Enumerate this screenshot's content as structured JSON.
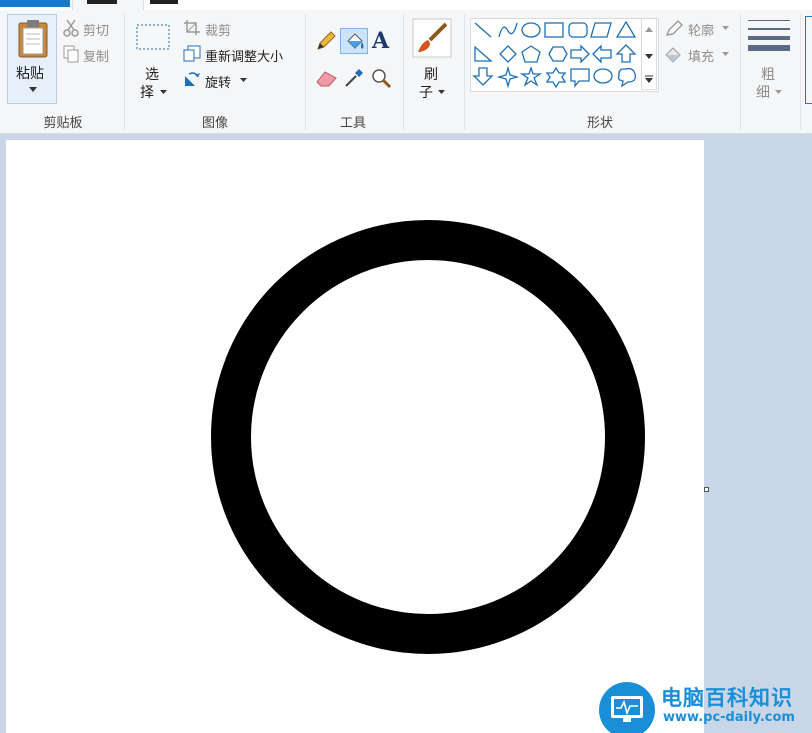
{
  "ribbon": {
    "clipboard": {
      "paste_label": "粘贴",
      "cut_label": "剪切",
      "copy_label": "复制",
      "group_label": "剪贴板"
    },
    "image": {
      "select_label_1": "选",
      "select_label_2": "择",
      "crop_label": "裁剪",
      "resize_label": "重新调整大小",
      "rotate_label": "旋转",
      "group_label": "图像"
    },
    "tools": {
      "group_label": "工具",
      "text_tool_glyph": "A"
    },
    "brushes": {
      "label_1": "刷",
      "label_2": "子"
    },
    "shapes": {
      "outline_label": "轮廓",
      "fill_label": "填充",
      "group_label": "形状"
    },
    "size": {
      "label_1": "粗",
      "label_2": "细"
    }
  },
  "watermark": {
    "title": "电脑百科知识",
    "url": "www.pc-daily.com"
  },
  "colors": {
    "accent": "#1979ca",
    "ribbon_bg": "#f5f6f7",
    "canvas_bg": "#ffffff",
    "workspace_bg": "#c9d6e8",
    "drawn_circle": "#000000"
  }
}
